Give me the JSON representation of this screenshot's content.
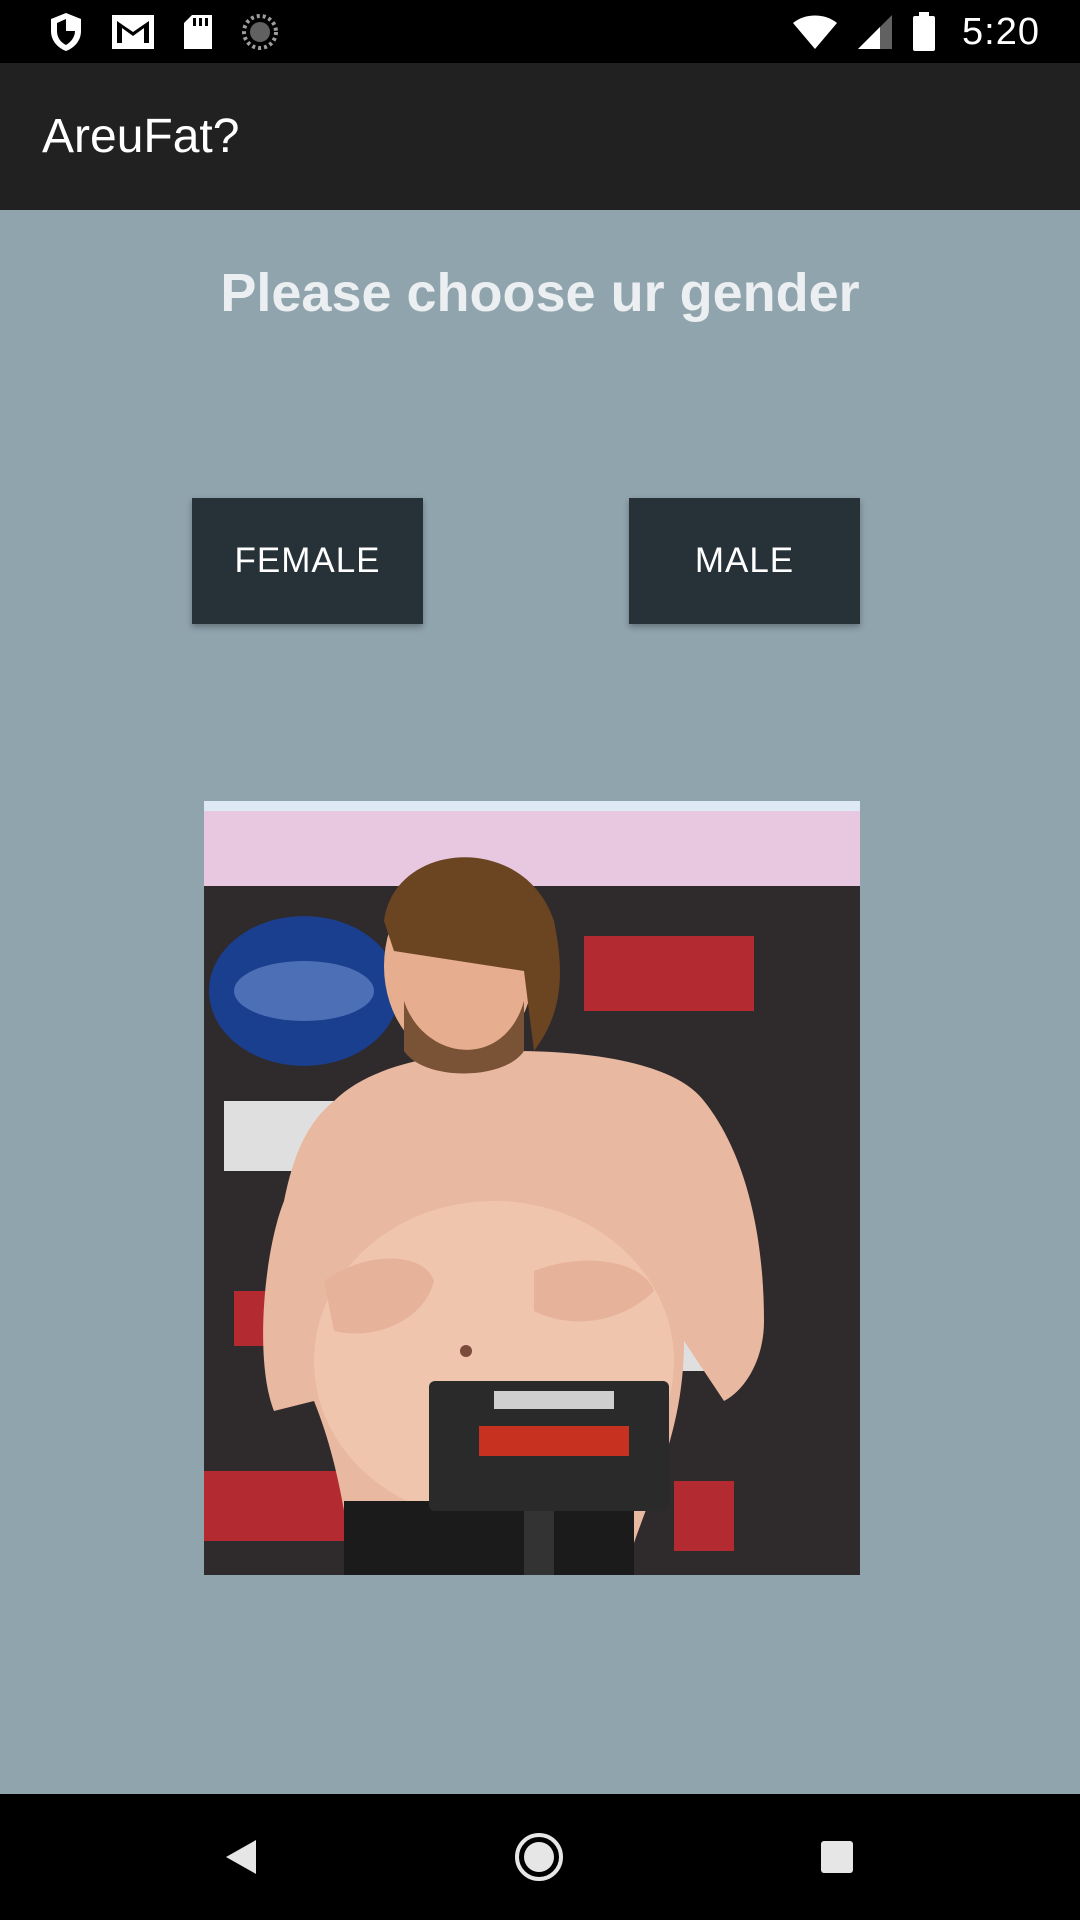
{
  "status_bar": {
    "time": "5:20",
    "icons": [
      "shield-icon",
      "gmail-icon",
      "sd-card-icon",
      "sync-icon",
      "wifi-icon",
      "signal-icon",
      "battery-icon"
    ]
  },
  "app_bar": {
    "title": "AreuFat?"
  },
  "main": {
    "prompt": "Please choose ur gender",
    "buttons": {
      "female_label": "FEMALE",
      "male_label": "MALE"
    },
    "photo_description_icon": "person-photo"
  },
  "nav_bar": {
    "icons": [
      "back-icon",
      "home-icon",
      "recents-icon"
    ]
  },
  "colors": {
    "background": "#90A4AE",
    "app_bar": "#212121",
    "button": "#263238",
    "prompt_text": "#ECEFF1"
  }
}
